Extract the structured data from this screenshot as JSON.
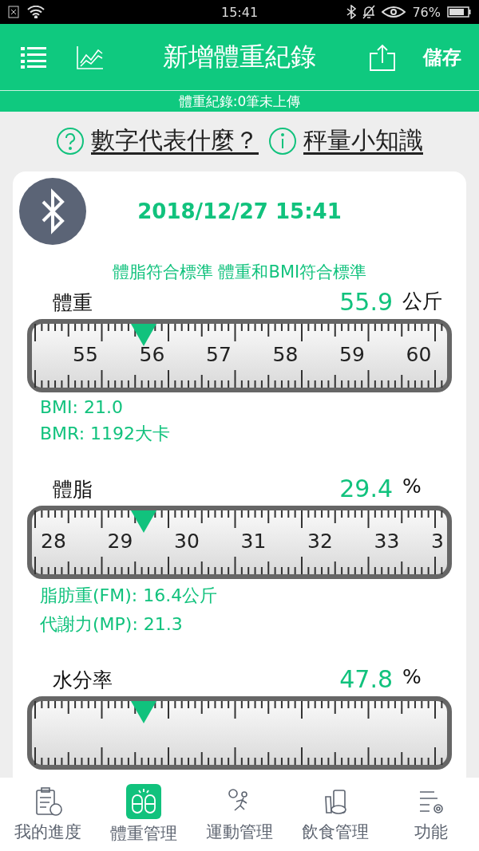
{
  "status_bar": {
    "time": "15:41",
    "battery": "76%"
  },
  "header": {
    "title": "新增體重紀錄",
    "save": "儲存"
  },
  "sync_notice": "體重紀錄:0筆未上傳",
  "help_links": [
    {
      "label": "數字代表什麼？"
    },
    {
      "label": "秤量小知識"
    }
  ],
  "record": {
    "datetime": "2018/12/27 15:41",
    "assessment": "體脂符合標準 體重和BMI符合標準",
    "metrics": [
      {
        "label": "體重",
        "value": "55.9",
        "unit": "公斤",
        "ticks": [
          "55",
          "56",
          "57",
          "58",
          "59",
          "60"
        ],
        "details": [
          "BMI: 21.0",
          "BMR: 1192大卡"
        ]
      },
      {
        "label": "體脂",
        "value": "29.4",
        "unit": "%",
        "ticks": [
          "28",
          "29",
          "30",
          "31",
          "32",
          "33",
          "3"
        ],
        "details": [
          "脂肪重(FM): 16.4公斤",
          "代謝力(MP): 21.3"
        ]
      },
      {
        "label": "水分率",
        "value": "47.8",
        "unit": "%"
      }
    ]
  },
  "bottom_nav": [
    {
      "label": "我的進度",
      "selected": false
    },
    {
      "label": "體重管理",
      "selected": true
    },
    {
      "label": "運動管理",
      "selected": false
    },
    {
      "label": "飲食管理",
      "selected": false
    },
    {
      "label": "功能",
      "selected": false
    }
  ]
}
